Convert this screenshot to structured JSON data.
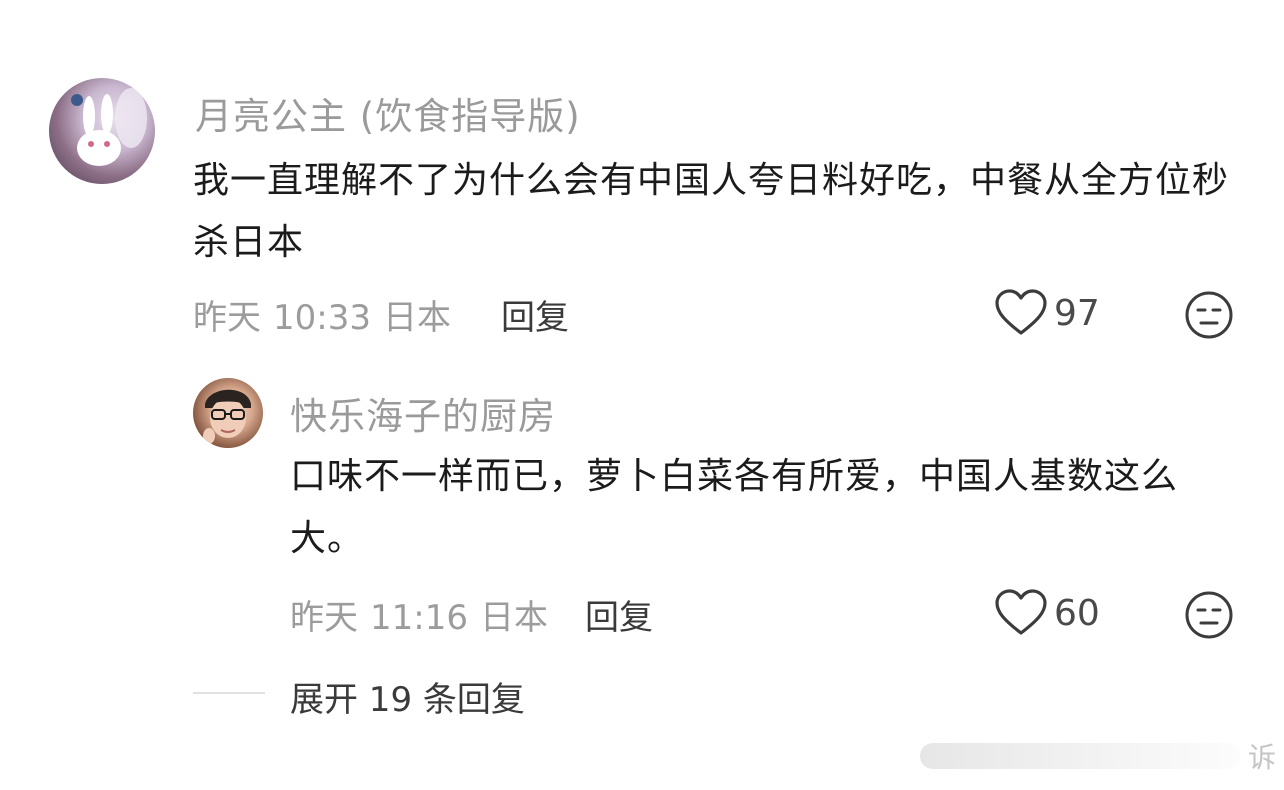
{
  "comment": {
    "username": "月亮公主 (饮食指导版)",
    "text": "我一直理解不了为什么会有中国人夸日料好吃，中餐从全方位秒杀日本",
    "date": "昨天",
    "time": "10:33",
    "location": "日本",
    "reply_label": "回复",
    "likes": "97",
    "avatar_icon": "bunny-anime-avatar-icon"
  },
  "reply": {
    "username": "快乐海子的厨房",
    "text": "口味不一样而已，萝卜白菜各有所爱，中国人基数这么大。",
    "date": "昨天",
    "time": "11:16",
    "location": "日本",
    "reply_label": "回复",
    "likes": "60",
    "avatar_icon": "person-glasses-avatar-icon"
  },
  "expand_replies": "展开 19 条回复",
  "watermark": "诉",
  "icons": {
    "like": "heart-outline-icon",
    "dislike": "neutral-face-icon"
  },
  "colors": {
    "username": "#9a9a9a",
    "text": "#1b1b1b",
    "meta": "#9c9c9c",
    "action": "#3a3a3a"
  }
}
